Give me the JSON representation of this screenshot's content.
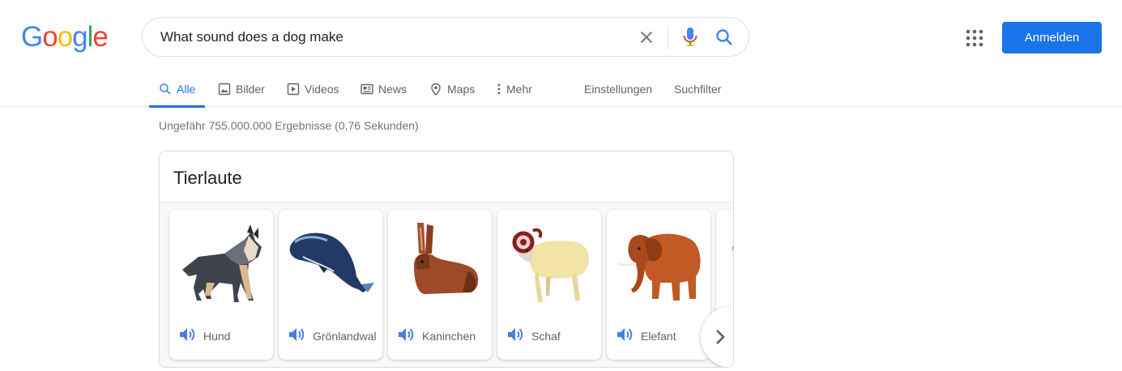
{
  "logo": {
    "text": "Google",
    "letters": [
      "G",
      "o",
      "o",
      "g",
      "l",
      "e"
    ],
    "colors": [
      "#4285F4",
      "#EA4335",
      "#FBBC05",
      "#4285F4",
      "#34A853",
      "#EA4335"
    ]
  },
  "search": {
    "query": "What sound does a dog make",
    "clear_icon": "close-icon",
    "mic_icon": "mic-icon",
    "search_icon": "search-icon"
  },
  "header": {
    "apps_icon": "apps-grid-icon",
    "signin_label": "Anmelden"
  },
  "tabs": [
    {
      "label": "Alle",
      "icon": "search-icon",
      "active": true
    },
    {
      "label": "Bilder",
      "icon": "image-icon"
    },
    {
      "label": "Videos",
      "icon": "play-icon"
    },
    {
      "label": "News",
      "icon": "news-icon"
    },
    {
      "label": "Maps",
      "icon": "map-pin-icon"
    },
    {
      "label": "Mehr",
      "icon": "more-vert-icon"
    },
    {
      "label": "Einstellungen"
    },
    {
      "label": "Suchfilter"
    }
  ],
  "result_stats": "Ungefähr 755.000.000 Ergebnisse (0,76 Sekunden)",
  "card": {
    "title": "Tierlaute",
    "animals": [
      {
        "label": "Hund",
        "icon": "dog-illustration"
      },
      {
        "label": "Grönlandwal",
        "icon": "whale-illustration"
      },
      {
        "label": "Kaninchen",
        "icon": "rabbit-illustration"
      },
      {
        "label": "Schaf",
        "icon": "ram-illustration"
      },
      {
        "label": "Elefant",
        "icon": "elephant-illustration"
      }
    ],
    "next_icon": "chevron-right-icon"
  },
  "colors": {
    "accent": "#1a73e8",
    "speaker": "#4a7ee0"
  }
}
